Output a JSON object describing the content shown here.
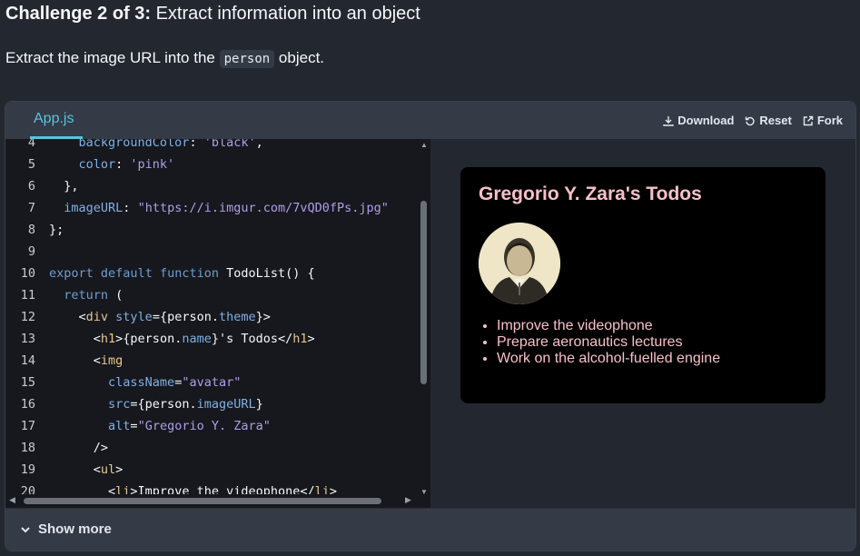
{
  "challenge": {
    "prefix": "Challenge 2 of 3:",
    "title": "Extract information into an object",
    "description_before": "Extract the image URL into the",
    "description_code": "person",
    "description_after": "object."
  },
  "sandbox": {
    "file_tab": "App.js",
    "actions": {
      "download": "Download",
      "reset": "Reset",
      "fork": "Fork"
    },
    "show_more": "Show more"
  },
  "code_lines": [
    {
      "n": "4",
      "text": "    backgroundColor: 'black',"
    },
    {
      "n": "5",
      "text": "    color: 'pink'"
    },
    {
      "n": "6",
      "text": "  },"
    },
    {
      "n": "7",
      "text": "  imageURL: \"https://i.imgur.com/7vQD0fPs.jpg\""
    },
    {
      "n": "8",
      "text": "};"
    },
    {
      "n": "9",
      "text": ""
    },
    {
      "n": "10",
      "text": "export default function TodoList() {"
    },
    {
      "n": "11",
      "text": "  return ("
    },
    {
      "n": "12",
      "text": "    <div style={person.theme}>"
    },
    {
      "n": "13",
      "text": "      <h1>{person.name}'s Todos</h1>"
    },
    {
      "n": "14",
      "text": "      <img"
    },
    {
      "n": "15",
      "text": "        className=\"avatar\""
    },
    {
      "n": "16",
      "text": "        src={person.imageURL}"
    },
    {
      "n": "17",
      "text": "        alt=\"Gregorio Y. Zara\""
    },
    {
      "n": "18",
      "text": "      />"
    },
    {
      "n": "19",
      "text": "      <ul>"
    },
    {
      "n": "20",
      "text": "        <li>Improve the videophone</li>"
    }
  ],
  "preview": {
    "heading": "Gregorio Y. Zara's Todos",
    "todos": [
      "Improve the videophone",
      "Prepare aeronautics lectures",
      "Work on the alcohol-fuelled engine"
    ]
  },
  "colors": {
    "accent": "#58c4dc",
    "card_text": "#f7c0c8",
    "background": "#23272f"
  }
}
